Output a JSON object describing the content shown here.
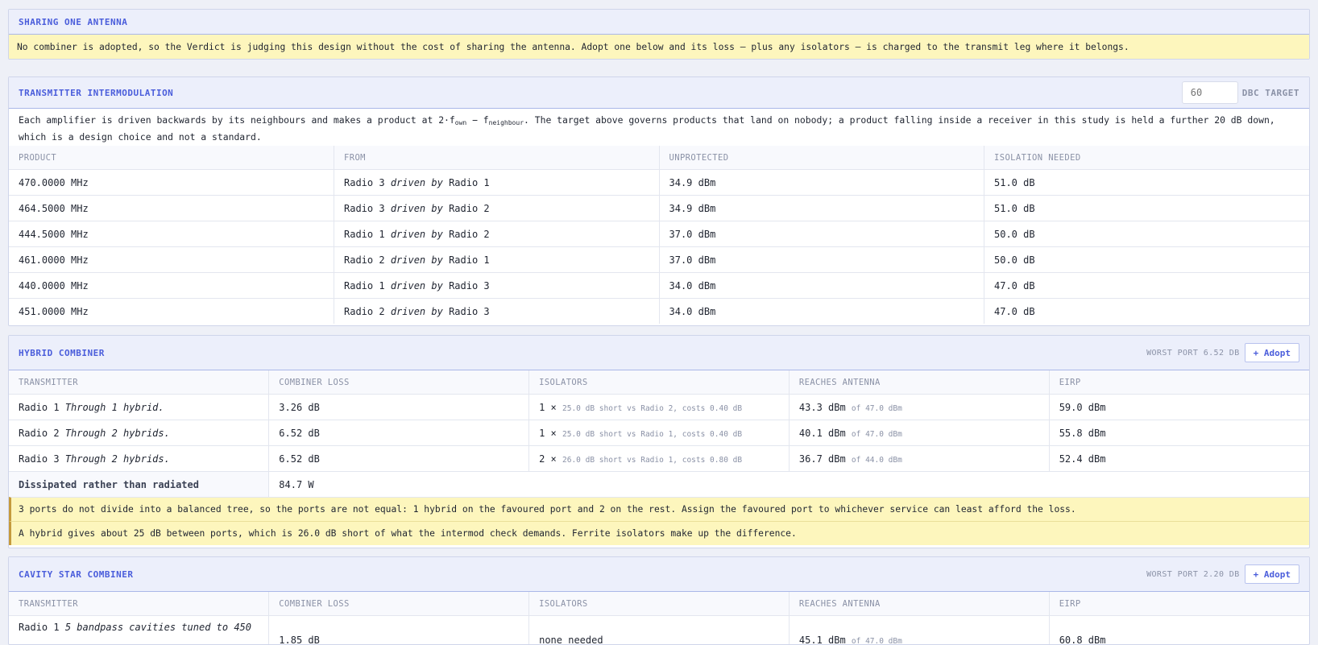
{
  "sharing": {
    "title": "SHARING ONE ANTENNA",
    "note": "No combiner is adopted, so the Verdict is judging this design without the cost of sharing the antenna. Adopt one below and its loss — plus any isolators — is charged to the transmit leg where it belongs."
  },
  "intermod": {
    "title": "TRANSMITTER INTERMODULATION",
    "target_placeholder": "60",
    "target_label": "DBC TARGET",
    "desc_a": "Each amplifier is driven backwards by its neighbours and makes a product at 2·f",
    "desc_sub1": "own",
    "desc_b": " − f",
    "desc_sub2": "neighbour",
    "desc_c": ". The target above governs products that land on nobody; a product falling inside a receiver in this study is held a further 20 dB down, which is a design choice and not a standard.",
    "columns": [
      "PRODUCT",
      "FROM",
      "UNPROTECTED",
      "ISOLATION NEEDED"
    ],
    "driven_word": "driven by",
    "rows": [
      {
        "product": "470.0000 MHz",
        "victim": "Radio 3",
        "source": "Radio 1",
        "unprotected": "34.9 dBm",
        "isolation": "51.0 dB"
      },
      {
        "product": "464.5000 MHz",
        "victim": "Radio 3",
        "source": "Radio 2",
        "unprotected": "34.9 dBm",
        "isolation": "51.0 dB"
      },
      {
        "product": "444.5000 MHz",
        "victim": "Radio 1",
        "source": "Radio 2",
        "unprotected": "37.0 dBm",
        "isolation": "50.0 dB"
      },
      {
        "product": "461.0000 MHz",
        "victim": "Radio 2",
        "source": "Radio 1",
        "unprotected": "37.0 dBm",
        "isolation": "50.0 dB"
      },
      {
        "product": "440.0000 MHz",
        "victim": "Radio 1",
        "source": "Radio 3",
        "unprotected": "34.0 dBm",
        "isolation": "47.0 dB"
      },
      {
        "product": "451.0000 MHz",
        "victim": "Radio 2",
        "source": "Radio 3",
        "unprotected": "34.0 dBm",
        "isolation": "47.0 dB"
      }
    ]
  },
  "hybrid": {
    "title": "HYBRID COMBINER",
    "worst_port": "WORST PORT 6.52 DB",
    "adopt_label": "+ Adopt",
    "columns": [
      "TRANSMITTER",
      "COMBINER LOSS",
      "ISOLATORS",
      "REACHES ANTENNA",
      "EIRP"
    ],
    "rows": [
      {
        "radio": "Radio 1",
        "via": "Through 1 hybrid.",
        "loss": "3.26 dB",
        "iso_count": "1 ×",
        "iso_detail": "25.0 dB short vs Radio 2, costs 0.40 dB",
        "reaches": "43.3 dBm",
        "of": "of 47.0 dBm",
        "eirp": "59.0 dBm"
      },
      {
        "radio": "Radio 2",
        "via": "Through 2 hybrids.",
        "loss": "6.52 dB",
        "iso_count": "1 ×",
        "iso_detail": "25.0 dB short vs Radio 1, costs 0.40 dB",
        "reaches": "40.1 dBm",
        "of": "of 47.0 dBm",
        "eirp": "55.8 dBm"
      },
      {
        "radio": "Radio 3",
        "via": "Through 2 hybrids.",
        "loss": "6.52 dB",
        "iso_count": "2 ×",
        "iso_detail": "26.0 dB short vs Radio 1, costs 0.80 dB",
        "reaches": "36.7 dBm",
        "of": "of 44.0 dBm",
        "eirp": "52.4 dBm"
      }
    ],
    "dissipated_label": "Dissipated rather than radiated",
    "dissipated_value": "84.7 W",
    "note1": "3 ports do not divide into a balanced tree, so the ports are not equal: 1 hybrid on the favoured port and 2 on the rest. Assign the favoured port to whichever service can least afford the loss.",
    "note2": "A hybrid gives about 25 dB between ports, which is 26.0 dB short of what the intermod check demands. Ferrite isolators make up the difference."
  },
  "cavity": {
    "title": "CAVITY STAR COMBINER",
    "worst_port": "WORST PORT 2.20 DB",
    "adopt_label": "+ Adopt",
    "columns": [
      "TRANSMITTER",
      "COMBINER LOSS",
      "ISOLATORS",
      "REACHES ANTENNA",
      "EIRP"
    ],
    "row": {
      "radio": "Radio 1",
      "via": "5 bandpass cavities tuned to 450",
      "loss": "1.85 dB",
      "isolators": "none needed",
      "reaches": "45.1 dBm",
      "of": "of 47.0 dBm",
      "eirp": "60.8 dBm"
    }
  }
}
